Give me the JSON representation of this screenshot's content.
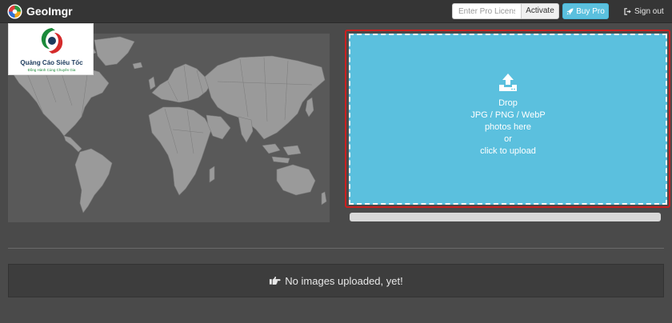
{
  "navbar": {
    "brand": "GeoImgr",
    "license_placeholder": "Enter Pro License",
    "activate_label": "Activate",
    "buy_pro_label": "Buy Pro",
    "signout_label": "Sign out"
  },
  "logo": {
    "title": "Quảng Cáo Siêu Tốc",
    "subtitle": "Đồng Hành Cùng Chuyên Gia"
  },
  "dropzone": {
    "lines": [
      "Drop",
      "JPG / PNG / WebP",
      "photos here",
      "or",
      "click to upload"
    ]
  },
  "upload_progress": {
    "fraction": 0
  },
  "gallery": {
    "empty_message": "No images uploaded, yet!"
  },
  "icons": {
    "brand": "map-pin-icon",
    "buy_pro": "rocket-icon",
    "signout": "sign-out-icon",
    "upload": "upload-icon",
    "empty": "hand-pointing-icon"
  },
  "colors": {
    "navbar_bg": "#353535",
    "page_bg": "#4a4a4a",
    "map_land": "#9a9a9a",
    "map_water": "#595959",
    "dropzone_bg": "#5bc0de",
    "highlight_border": "#cc1f1f",
    "buy_pro_bg": "#5bc0de"
  }
}
